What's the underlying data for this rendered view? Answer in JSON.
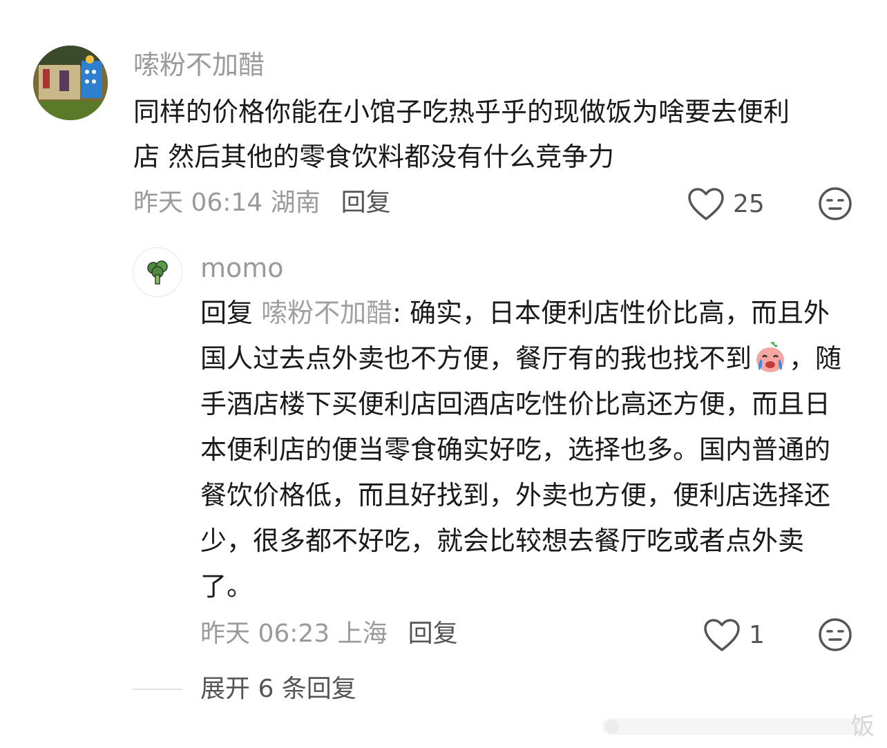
{
  "comment": {
    "username": "嗦粉不加醋",
    "text_line1": "同样的价格你能在小馆子吃热乎乎的现做饭为啥要去便利",
    "text_line2": "店 然后其他的零食饮料都没有什么竞争力",
    "meta": "昨天 06:14 湖南",
    "reply_label": "回复",
    "likes": "25"
  },
  "reply": {
    "username": "momo",
    "prefix": "回复 ",
    "mention": "嗦粉不加醋",
    "text_part1": ": 确实，日本便利店性价比高，而且外国人过去点外卖也不方便，餐厅有的我也找不到",
    "text_part2": "，随手酒店楼下买便利店回酒店吃性价比高还方便，而且日本便利店的便当零食确实好吃，选择也多。国内普通的餐饮价格低，而且好找到，外卖也方便，便利店选择还少，很多都不好吃，就会比较想去餐厅吃或者点外卖了。",
    "meta": "昨天 06:23 上海",
    "reply_label": "回复",
    "likes": "1"
  },
  "expand_label": "展开 6 条回复",
  "watermark_char": "饭",
  "icons": {
    "like": "heart-outline-icon",
    "dislike": "neutral-face-icon",
    "emoji": "crying-laughing-emoji",
    "sub_avatar": "broccoli-icon"
  }
}
